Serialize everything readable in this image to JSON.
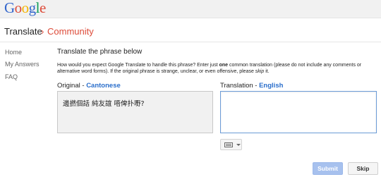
{
  "logo": {
    "letters": [
      "G",
      "o",
      "o",
      "g",
      "l",
      "e"
    ],
    "colors": [
      "#3366cc",
      "#dd4b39",
      "#f4b400",
      "#3366cc",
      "#0f9d58",
      "#dd4b39"
    ]
  },
  "breadcrumb": {
    "root": "Translate",
    "separator": "›",
    "current": "Community"
  },
  "nav": {
    "items": [
      "Home",
      "My Answers",
      "FAQ"
    ]
  },
  "main": {
    "heading": "Translate the phrase below",
    "instructions": {
      "part1": "How would you expect Google Translate to handle this phrase? Enter just ",
      "bold": "one",
      "part2": " common translation (please do not include any comments or alternative word forms). If the original phrase is strange, unclear, or even offensive, please ",
      "italic": "skip",
      "part3": " it."
    },
    "original_label": "Original - ",
    "original_lang": "Cantonese",
    "translation_label": "Translation - ",
    "translation_lang": "English",
    "source_phrase": "邊撚個話 純友誼 唔俾扑嘢?",
    "translation_value": ""
  },
  "buttons": {
    "submit": "Submit",
    "skip": "Skip"
  },
  "icons": {
    "keyboard": "keyboard-icon",
    "dropdown": "chevron-down-icon"
  }
}
